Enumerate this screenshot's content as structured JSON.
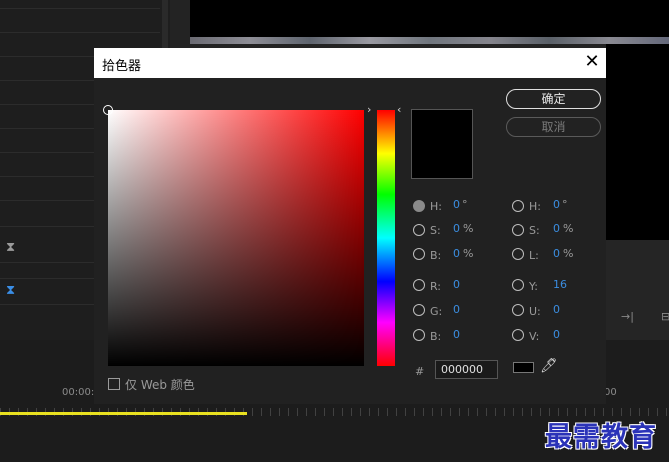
{
  "background": {
    "time_left": "00:00:",
    "time_right": "00"
  },
  "dialog": {
    "title": "拾色器",
    "ok_label": "确定",
    "cancel_label": "取消",
    "hsb": {
      "h_label": "H:",
      "h_value": "0",
      "h_unit": "°",
      "s_label": "S:",
      "s_value": "0",
      "s_unit": "%",
      "b_label": "B:",
      "b_value": "0",
      "b_unit": "%"
    },
    "rgb": {
      "r_label": "R:",
      "r_value": "0",
      "g_label": "G:",
      "g_value": "0",
      "b_label": "B:",
      "b_value": "0"
    },
    "hsl": {
      "h_label": "H:",
      "h_value": "0",
      "h_unit": "°",
      "s_label": "S:",
      "s_value": "0",
      "s_unit": "%",
      "l_label": "L:",
      "l_value": "0",
      "l_unit": "%"
    },
    "yuv": {
      "y_label": "Y:",
      "y_value": "16",
      "u_label": "U:",
      "u_value": "0",
      "v_label": "V:",
      "v_value": "0"
    },
    "hash": "#",
    "hex_value": "000000",
    "web_only_label": "仅 Web 颜色",
    "current_color": "#000000",
    "hue_color": "#ff0000"
  },
  "watermark": "最需教育"
}
